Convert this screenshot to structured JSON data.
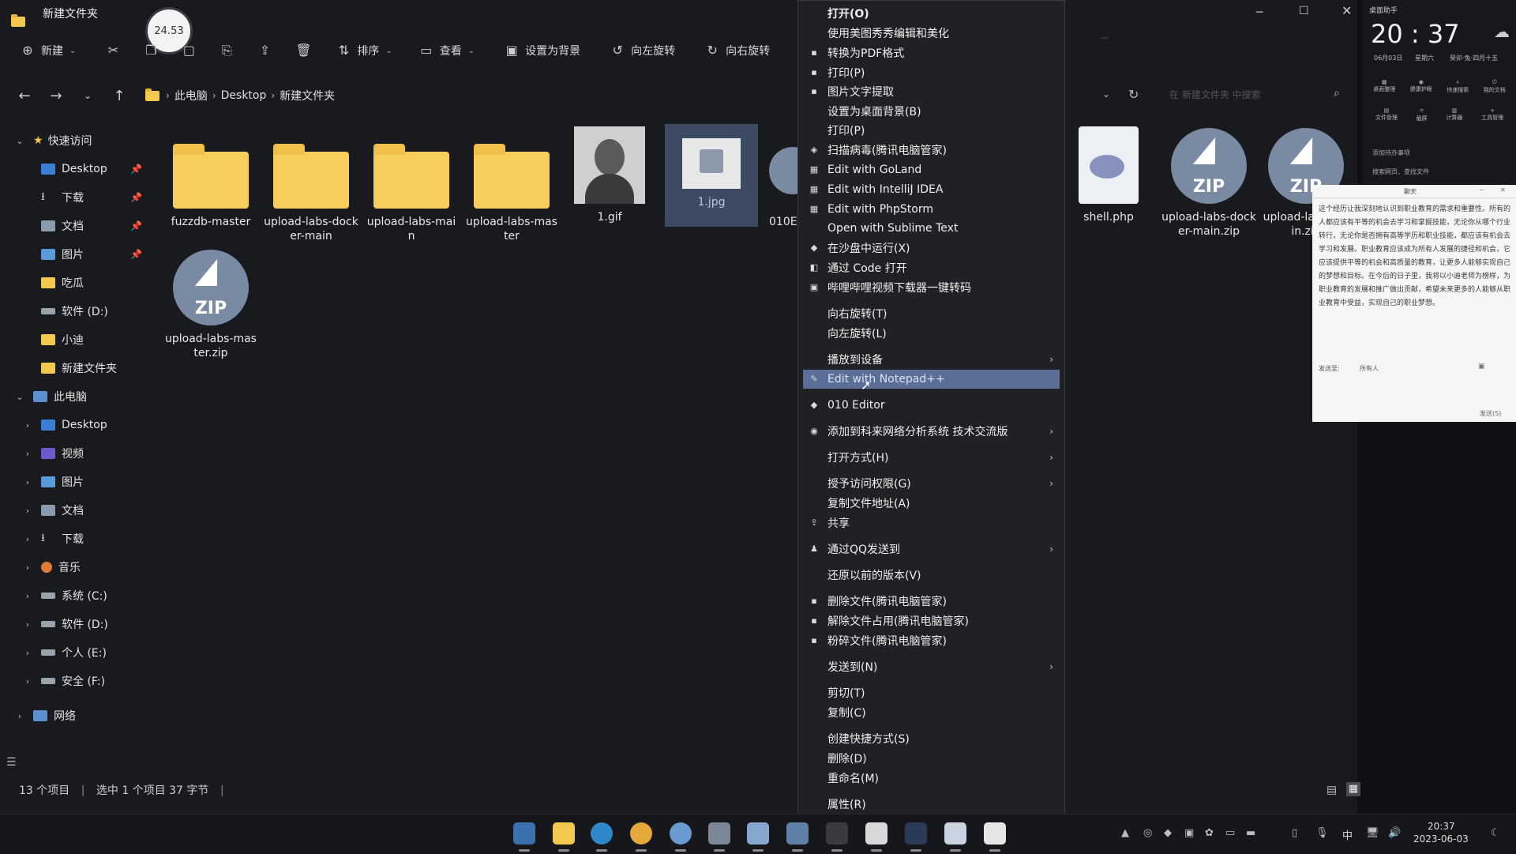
{
  "explorer": {
    "title": "新建文件夹",
    "timer_bubble": "24.53",
    "toolbar": {
      "new_label": "新建",
      "sort_label": "排序",
      "view_label": "查看",
      "set_bg_label": "设置为背景",
      "rotate_left_label": "向左旋转",
      "rotate_right_label": "向右旋转"
    },
    "breadcrumb": [
      "此电脑",
      "Desktop",
      "新建文件夹"
    ],
    "search_placeholder": "在 新建文件夹 中搜索",
    "sidebar": {
      "quick_access": "快速访问",
      "quick_items": [
        "Desktop",
        "下载",
        "文档",
        "图片",
        "吃瓜",
        "软件 (D:)",
        "小迪",
        "新建文件夹"
      ],
      "this_pc": "此电脑",
      "pc_items": [
        "Desktop",
        "视频",
        "图片",
        "文档",
        "下载",
        "音乐",
        "系统 (C:)",
        "软件 (D:)",
        "个人 (E:)",
        "安全 (F:)"
      ],
      "network": "网络"
    },
    "files": [
      {
        "name": "fuzzdb-master",
        "kind": "folder"
      },
      {
        "name": "upload-labs-docker-main",
        "kind": "folder"
      },
      {
        "name": "upload-labs-main",
        "kind": "folder"
      },
      {
        "name": "upload-labs-master",
        "kind": "folder"
      },
      {
        "name": "1.gif",
        "kind": "image"
      },
      {
        "name": "1.jpg",
        "kind": "image-selected"
      },
      {
        "name": "010E",
        "kind": "partial"
      },
      {
        "name": "upload-labs-master.zip",
        "kind": "zip"
      }
    ],
    "right_files": [
      {
        "name": "shell.php",
        "kind": "php"
      },
      {
        "name": "upload-labs-docker-main.zip",
        "kind": "zip"
      },
      {
        "name": "upload-labs-main.zip",
        "kind": "zip"
      }
    ],
    "status": {
      "count": "13 个项目",
      "selected": "选中 1 个项目 37 字节"
    }
  },
  "context_menu": {
    "items": [
      {
        "label": "打开(O)",
        "icon": "",
        "bold": true
      },
      {
        "label": "使用美图秀秀编辑和美化",
        "icon": ""
      },
      {
        "label": "转换为PDF格式",
        "icon": "doc-icon"
      },
      {
        "label": "打印(P)",
        "icon": "doc-icon"
      },
      {
        "label": "图片文字提取",
        "icon": "doc-icon"
      },
      {
        "label": "设置为桌面背景(B)",
        "icon": ""
      },
      {
        "label": "打印(P)",
        "icon": ""
      },
      {
        "label": "扫描病毒(腾讯电脑管家)",
        "icon": "shield-icon"
      },
      {
        "label": "Edit with GoLand",
        "icon": "goland-icon"
      },
      {
        "label": "Edit with IntelliJ IDEA",
        "icon": "idea-icon"
      },
      {
        "label": "Edit with PhpStorm",
        "icon": "phpstorm-icon"
      },
      {
        "label": "Open with Sublime Text",
        "icon": ""
      },
      {
        "label": "在沙盘中运行(X)",
        "icon": "sandbox-icon"
      },
      {
        "label": "通过 Code 打开",
        "icon": "vscode-icon"
      },
      {
        "label": "哔哩哔哩视频下载器一键转码",
        "icon": "bili-icon"
      },
      {
        "label": "向右旋转(T)",
        "icon": ""
      },
      {
        "label": "向左旋转(L)",
        "icon": ""
      },
      {
        "label": "播放到设备",
        "icon": "",
        "submenu": true
      },
      {
        "label": "Edit with Notepad++",
        "icon": "notepad-icon",
        "highlight": true
      },
      {
        "label": "010 Editor",
        "icon": "editor-icon"
      },
      {
        "label": "添加到科来网络分析系统 技术交流版",
        "icon": "globe-icon",
        "submenu": true
      },
      {
        "label": "打开方式(H)",
        "icon": "",
        "submenu": true
      },
      {
        "label": "授予访问权限(G)",
        "icon": "",
        "submenu": true
      },
      {
        "label": "复制文件地址(A)",
        "icon": ""
      },
      {
        "label": "共享",
        "icon": "share-icon"
      },
      {
        "label": "通过QQ发送到",
        "icon": "qq-icon",
        "submenu": true
      },
      {
        "label": "还原以前的版本(V)",
        "icon": ""
      },
      {
        "label": "删除文件(腾讯电脑管家)",
        "icon": "delete-icon"
      },
      {
        "label": "解除文件占用(腾讯电脑管家)",
        "icon": "unlock-icon"
      },
      {
        "label": "粉碎文件(腾讯电脑管家)",
        "icon": "shred-icon"
      },
      {
        "label": "发送到(N)",
        "icon": "",
        "submenu": true
      },
      {
        "label": "剪切(T)",
        "icon": ""
      },
      {
        "label": "复制(C)",
        "icon": ""
      },
      {
        "label": "创建快捷方式(S)",
        "icon": ""
      },
      {
        "label": "删除(D)",
        "icon": ""
      },
      {
        "label": "重命名(M)",
        "icon": ""
      },
      {
        "label": "属性(R)",
        "icon": ""
      }
    ]
  },
  "widget": {
    "title": "桌面助手",
    "time": "20 : 37",
    "date": "06月03日",
    "weekday": "星期六",
    "lunar": "癸卯·兔·四月十五",
    "tools_row1": [
      "桌面整理",
      "健康护眼",
      "快速搜索",
      "我的文档"
    ],
    "tools_row2": [
      "文件管理",
      "截屏",
      "计算器",
      "工具管理"
    ],
    "todo": "添加待办事项",
    "search": "搜索网页、查找文件"
  },
  "chat": {
    "title": "聊天",
    "text": "这个经历让我深刻地认识到职业教育的需求和重要性。所有的人都应该有平等的机会去学习和掌握技能，无论你从哪个行业转行，无论你是否拥有高等学历和职业技能，都应该有机会去学习和发展。职业教育应该成为所有人发展的捷径和机会，它应该提供平等的机会和高质量的教育，让更多人能够实现自己的梦想和目标。在今后的日子里，我将以小迪老师为榜样，为职业教育的发展和推广做出贡献，希望未来更多的人能够从职业教育中受益，实现自己的职业梦想。",
    "send_to_label": "发送至:",
    "send_to_value": "所有人",
    "send_button": "发送(S)"
  },
  "taskbar": {
    "time": "20:37",
    "date": "2023-06-03",
    "ime": "中"
  },
  "colors": {
    "menu_highlight": "#5a6e97",
    "folder": "#f7ce5b",
    "zip": "#7b8aa3"
  }
}
